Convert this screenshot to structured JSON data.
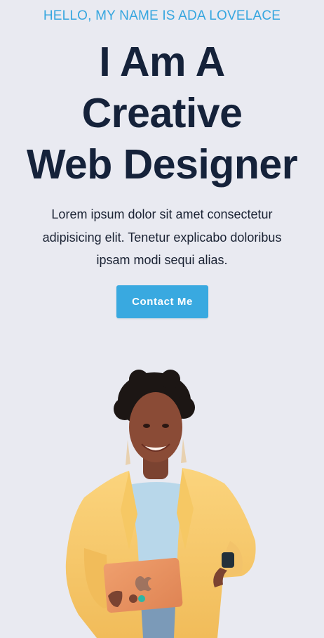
{
  "hero": {
    "greeting": "HELLO, MY NAME IS ADA LOVELACE",
    "headline_lines": [
      "I Am A",
      "Creative",
      "Web Designer"
    ],
    "intro_lines": [
      "Lorem ipsum dolor sit amet consectetur",
      "adipisicing elit. Tenetur explicabo doloribus",
      "ipsam modi sequi alias."
    ],
    "cta_label": "Contact Me"
  },
  "colors": {
    "background": "#e9eaf1",
    "accent": "#36a6df",
    "headline": "#15223a",
    "button": "#39a9e0",
    "button_text": "#ffffff"
  },
  "icons": {
    "tablet_logo": "apple-logo-icon"
  }
}
